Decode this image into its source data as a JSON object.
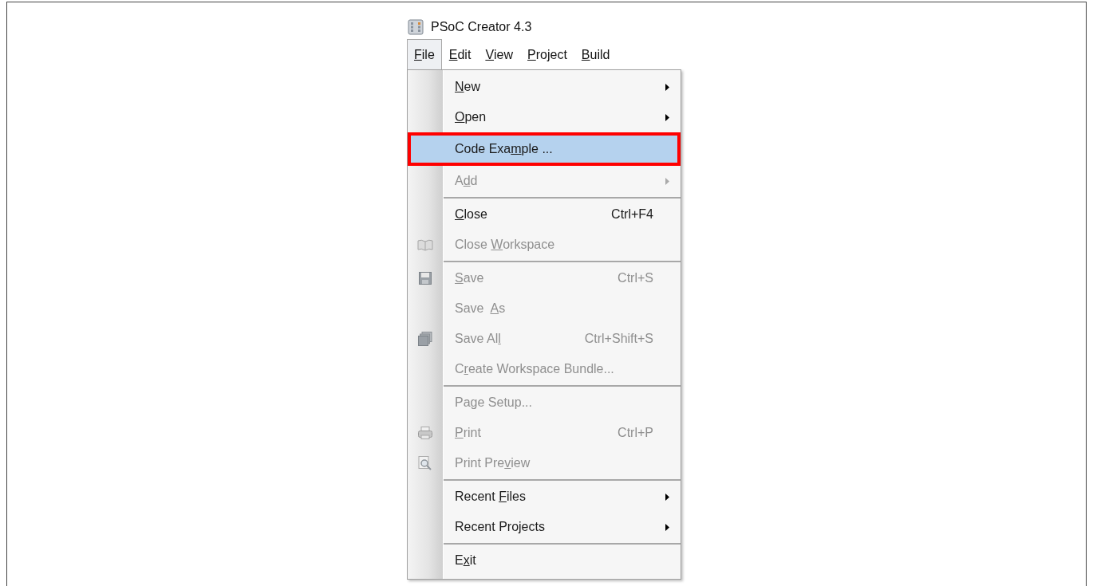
{
  "window": {
    "title": "PSoC Creator 4.3"
  },
  "menu_bar": [
    {
      "label": {
        "key": "F",
        "after": "ile"
      },
      "selected": true
    },
    {
      "label": {
        "key": "E",
        "after": "dit"
      },
      "selected": false
    },
    {
      "label": {
        "key": "V",
        "after": "iew"
      },
      "selected": false
    },
    {
      "label": {
        "key": "P",
        "after": "roject"
      },
      "selected": false
    },
    {
      "label": {
        "key": "B",
        "after": "uild"
      },
      "selected": false
    }
  ],
  "file_menu": [
    {
      "kind": "item",
      "label": {
        "key": "N",
        "after": "ew"
      },
      "submenu": true,
      "disabled": false,
      "selected": false,
      "outlined": false
    },
    {
      "kind": "item",
      "label": {
        "key": "O",
        "after": "pen"
      },
      "submenu": true,
      "disabled": false,
      "selected": false,
      "outlined": false
    },
    {
      "kind": "item",
      "label": {
        "before": "Code Exa",
        "key": "m",
        "after": "ple ..."
      },
      "submenu": false,
      "disabled": false,
      "selected": true,
      "outlined": true
    },
    {
      "kind": "item",
      "label": {
        "before": "A",
        "key": "d",
        "after": "d"
      },
      "submenu": true,
      "disabled": true,
      "selected": false,
      "outlined": false
    },
    {
      "kind": "separator"
    },
    {
      "kind": "item",
      "label": {
        "key": "C",
        "after": "lose"
      },
      "shortcut": "Ctrl+F4",
      "submenu": false,
      "disabled": false,
      "selected": false,
      "outlined": false
    },
    {
      "kind": "item",
      "label": {
        "before": "Close ",
        "key": "W",
        "after": "orkspace"
      },
      "submenu": false,
      "disabled": true,
      "selected": false,
      "outlined": false
    },
    {
      "kind": "separator"
    },
    {
      "kind": "item",
      "label": {
        "key": "S",
        "after": "ave"
      },
      "shortcut": "Ctrl+S",
      "submenu": false,
      "disabled": true,
      "selected": false,
      "outlined": false
    },
    {
      "kind": "item",
      "label": {
        "before": "Save  ",
        "key": "A",
        "after": "s"
      },
      "submenu": false,
      "disabled": true,
      "selected": false,
      "outlined": false
    },
    {
      "kind": "item",
      "label": {
        "before": "Save Al",
        "key": "l"
      },
      "shortcut": "Ctrl+Shift+S",
      "submenu": false,
      "disabled": true,
      "selected": false,
      "outlined": false
    },
    {
      "kind": "item",
      "label": {
        "before": "C",
        "key": "r",
        "after": "eate Workspace Bundle..."
      },
      "submenu": false,
      "disabled": true,
      "selected": false,
      "outlined": false
    },
    {
      "kind": "separator"
    },
    {
      "kind": "item",
      "label": {
        "before": "Page Setup..."
      },
      "submenu": false,
      "disabled": true,
      "selected": false,
      "outlined": false
    },
    {
      "kind": "item",
      "label": {
        "key": "P",
        "after": "rint"
      },
      "shortcut": "Ctrl+P",
      "submenu": false,
      "disabled": true,
      "selected": false,
      "outlined": false
    },
    {
      "kind": "item",
      "label": {
        "before": "Print Pre",
        "key": "v",
        "after": "iew"
      },
      "submenu": false,
      "disabled": true,
      "selected": false,
      "outlined": false
    },
    {
      "kind": "separator"
    },
    {
      "kind": "item",
      "label": {
        "before": "Recent ",
        "key": "F",
        "after": "iles"
      },
      "submenu": true,
      "disabled": false,
      "selected": false,
      "outlined": false
    },
    {
      "kind": "item",
      "label": {
        "before": "Recent Projects"
      },
      "submenu": true,
      "disabled": false,
      "selected": false,
      "outlined": false
    },
    {
      "kind": "separator"
    },
    {
      "kind": "item",
      "label": {
        "before": "E",
        "key": "x",
        "after": "it"
      },
      "submenu": false,
      "disabled": false,
      "selected": false,
      "outlined": false
    }
  ]
}
